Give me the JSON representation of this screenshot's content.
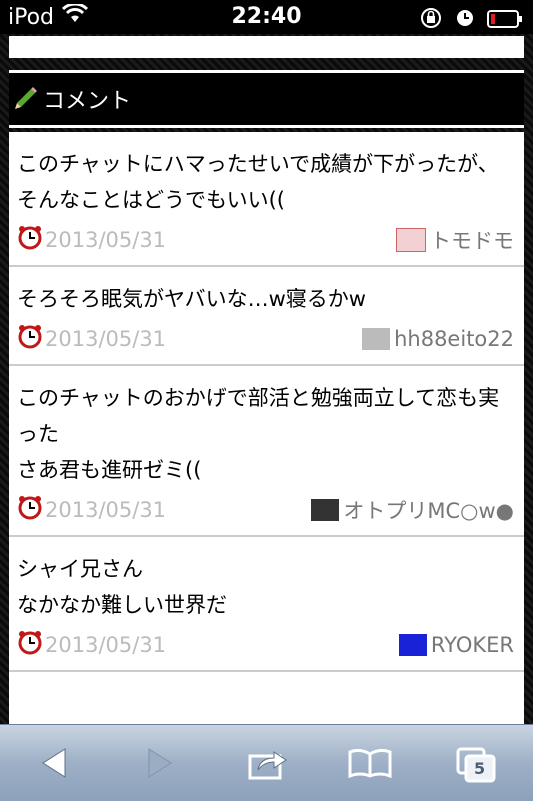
{
  "status": {
    "carrier": "iPod",
    "time": "22:40"
  },
  "header": {
    "title": "コメント"
  },
  "comments": [
    {
      "text": "このチャットにハマったせいで成績が下がったが、\nそんなことはどうでもいい((",
      "date": "2013/05/31",
      "user": "トモドモ"
    },
    {
      "text": "そろそろ眠気がヤバいな…w寝るかw",
      "date": "2013/05/31",
      "user": "hh88eito22"
    },
    {
      "text": "このチャットのおかげで部活と勉強両立して恋も実った\nさあ君も進研ゼミ((",
      "date": "2013/05/31",
      "user": "オトプリMC○w●"
    },
    {
      "text": "シャイ兄さん\nなかなか難しい世界だ",
      "date": "2013/05/31",
      "user": "RYOKER"
    }
  ],
  "toolbar": {
    "tabs_count": "5"
  },
  "colors": {
    "toolbar": "#9eb0c6",
    "date_text": "#bbbbbb"
  }
}
